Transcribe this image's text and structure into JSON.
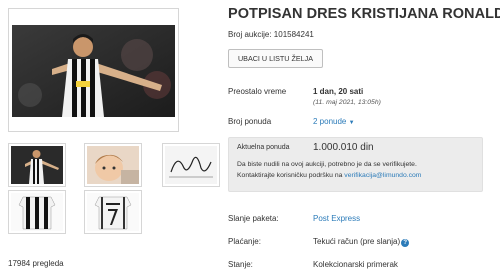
{
  "listing": {
    "title": "POTPISAN DRES KRISTIJANA RONALDA",
    "auction_number": "Broj aukcije: 101584241",
    "watch_button": "UBACI U LISTU ŽELJA",
    "views": "17984 pregleda"
  },
  "details": {
    "time_left_label": "Preostalo vreme",
    "time_left_value": "1 dan, 20 sati",
    "end_date": "(11. maj 2021, 13:05h)",
    "bids_label": "Broj ponuda",
    "bids_value": "2 ponude",
    "caret_glyph": "▼",
    "package_label": "Slanje paketa:",
    "package_value": "Post Express",
    "payment_label": "Plaćanje:",
    "payment_value": "Tekući račun (pre slanja)",
    "info_glyph": "?",
    "condition_label": "Stanje:",
    "condition_value": "Kolekcionarski primerak"
  },
  "bid_box": {
    "current_label": "Aktuelna ponuda",
    "current_amount": "1.000.010 din",
    "message_line1": "Da biste nudili na ovoj aukciji, potrebno je da se verifikujete.",
    "message_line2_prefix": "Kontaktirajte korisničku podršku na ",
    "support_email": "verifikacija@limundo.com"
  },
  "colors": {
    "link": "#2b7bb9",
    "box_bg": "#ececec",
    "text": "#333333"
  }
}
